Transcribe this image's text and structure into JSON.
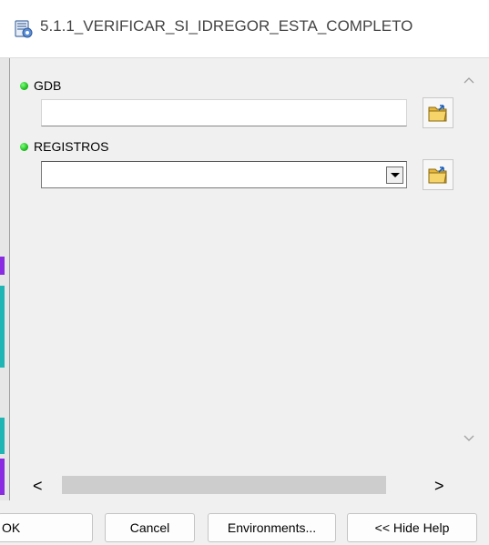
{
  "window": {
    "title": "5.1.1_VERIFICAR_SI_IDREGOR_ESTA_COMPLETO",
    "icon": "script-tool-icon"
  },
  "params": [
    {
      "label": "GDB",
      "value": "",
      "control": "text-input",
      "required": true
    },
    {
      "label": "REGISTROS",
      "value": "",
      "control": "combo-box",
      "required": true
    }
  ],
  "buttons": {
    "ok": "OK",
    "cancel": "Cancel",
    "environments": "Environments...",
    "hide_help": "<< Hide Help"
  },
  "scroll": {
    "left": "<",
    "right": ">"
  },
  "colors": {
    "required_dot": "#13b313",
    "title_text": "#444444",
    "background": "#f0f0f0"
  }
}
